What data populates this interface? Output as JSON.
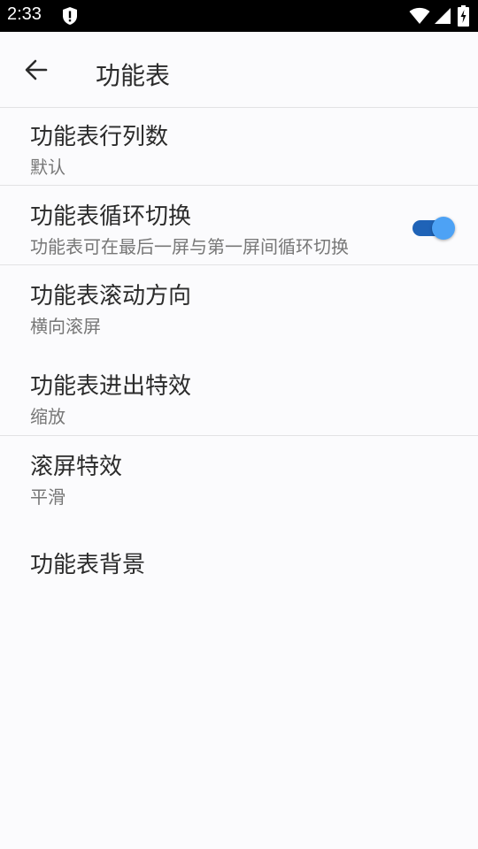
{
  "status_bar": {
    "time": "2:33"
  },
  "app_bar": {
    "title": "功能表"
  },
  "items": [
    {
      "title": "功能表行列数",
      "summary": "默认"
    },
    {
      "title": "功能表循环切换",
      "summary": "功能表可在最后一屏与第一屏间循环切换",
      "toggle_on": true
    },
    {
      "title": "功能表滚动方向",
      "summary": "横向滚屏"
    },
    {
      "title": "功能表进出特效",
      "summary": "缩放"
    },
    {
      "title": "滚屏特效",
      "summary": "平滑"
    },
    {
      "title": "功能表背景"
    }
  ],
  "icons": {
    "status": [
      "shield-icon",
      "wifi-icon",
      "signal-icon",
      "battery-icon"
    ],
    "app_bar": "arrow-back-icon"
  },
  "colors": {
    "toggle_track": "#1f63b7",
    "toggle_thumb": "#4da2f5",
    "divider": "#e2e2e4"
  }
}
